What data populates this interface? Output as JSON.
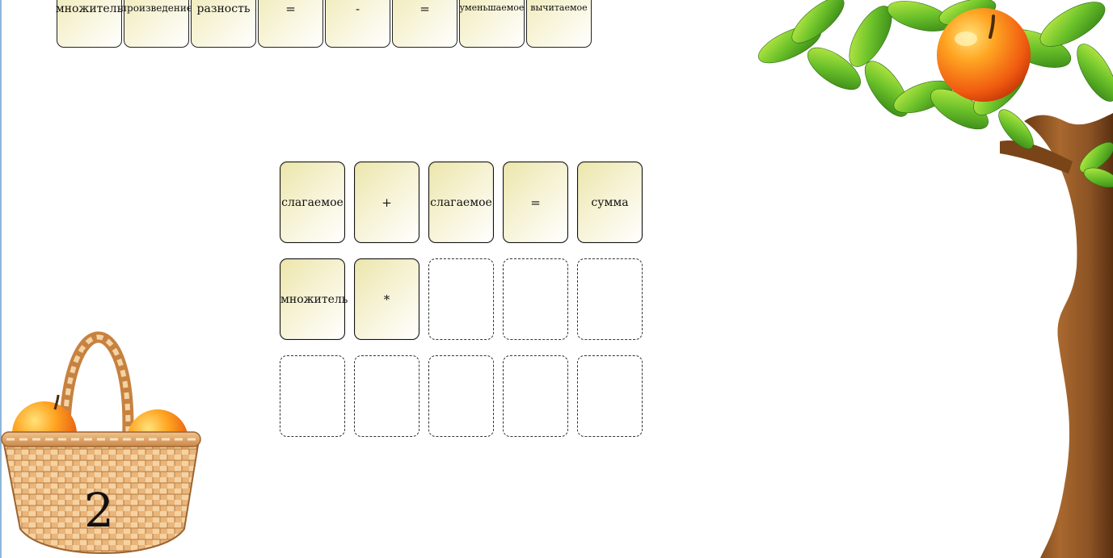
{
  "word_bank": [
    {
      "label": "множитель"
    },
    {
      "label": "произведение"
    },
    {
      "label": "разность"
    },
    {
      "label": "="
    },
    {
      "label": "-"
    },
    {
      "label": "="
    },
    {
      "label": "уменьшаемое"
    },
    {
      "label": "вычитаемое"
    }
  ],
  "grid": {
    "rows": [
      [
        "слагаемое",
        "+",
        "слагаемое",
        "=",
        "сумма"
      ],
      [
        "множитель",
        "*",
        "",
        "",
        ""
      ],
      [
        "",
        "",
        "",
        "",
        ""
      ]
    ]
  },
  "basket": {
    "count": "2"
  },
  "colors": {
    "card_tint": "#ece6ab",
    "apple": "#f07a1a",
    "leaf": "#6fbf2a",
    "trunk": "#8a5628"
  }
}
